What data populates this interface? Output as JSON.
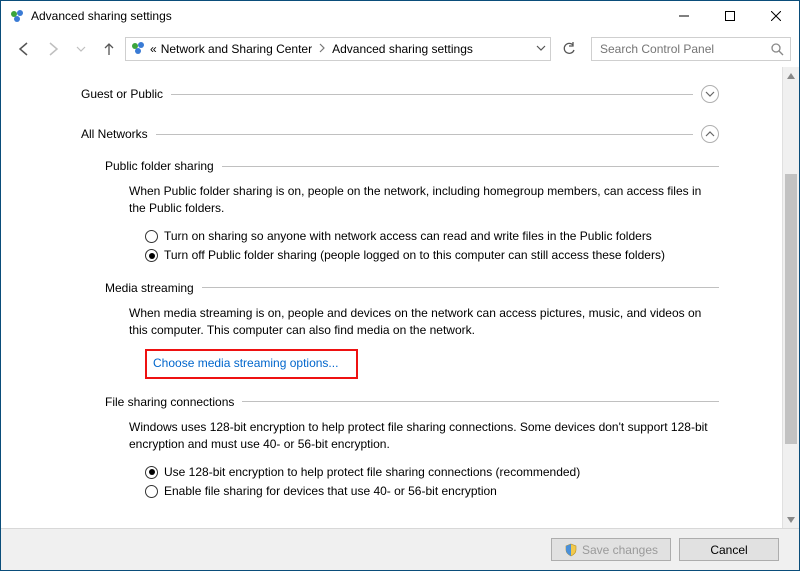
{
  "window": {
    "title": "Advanced sharing settings"
  },
  "breadcrumb": {
    "prefix": "«",
    "parent": "Network and Sharing Center",
    "current": "Advanced sharing settings"
  },
  "search": {
    "placeholder": "Search Control Panel"
  },
  "profiles": {
    "guest": {
      "label": "Guest or Public"
    },
    "all": {
      "label": "All Networks"
    }
  },
  "sections": {
    "publicFolder": {
      "title": "Public folder sharing",
      "description": "When Public folder sharing is on, people on the network, including homegroup members, can access files in the Public folders.",
      "option_on": "Turn on sharing so anyone with network access can read and write files in the Public folders",
      "option_off": "Turn off Public folder sharing (people logged on to this computer can still access these folders)"
    },
    "mediaStreaming": {
      "title": "Media streaming",
      "description": "When media streaming is on, people and devices on the network can access pictures, music, and videos on this computer. This computer can also find media on the network.",
      "link": "Choose media streaming options..."
    },
    "fileSharing": {
      "title": "File sharing connections",
      "description": "Windows uses 128-bit encryption to help protect file sharing connections. Some devices don't support 128-bit encryption and must use 40- or 56-bit encryption.",
      "option_128": "Use 128-bit encryption to help protect file sharing connections (recommended)",
      "option_40": "Enable file sharing for devices that use 40- or 56-bit encryption"
    }
  },
  "footer": {
    "save": "Save changes",
    "cancel": "Cancel"
  }
}
